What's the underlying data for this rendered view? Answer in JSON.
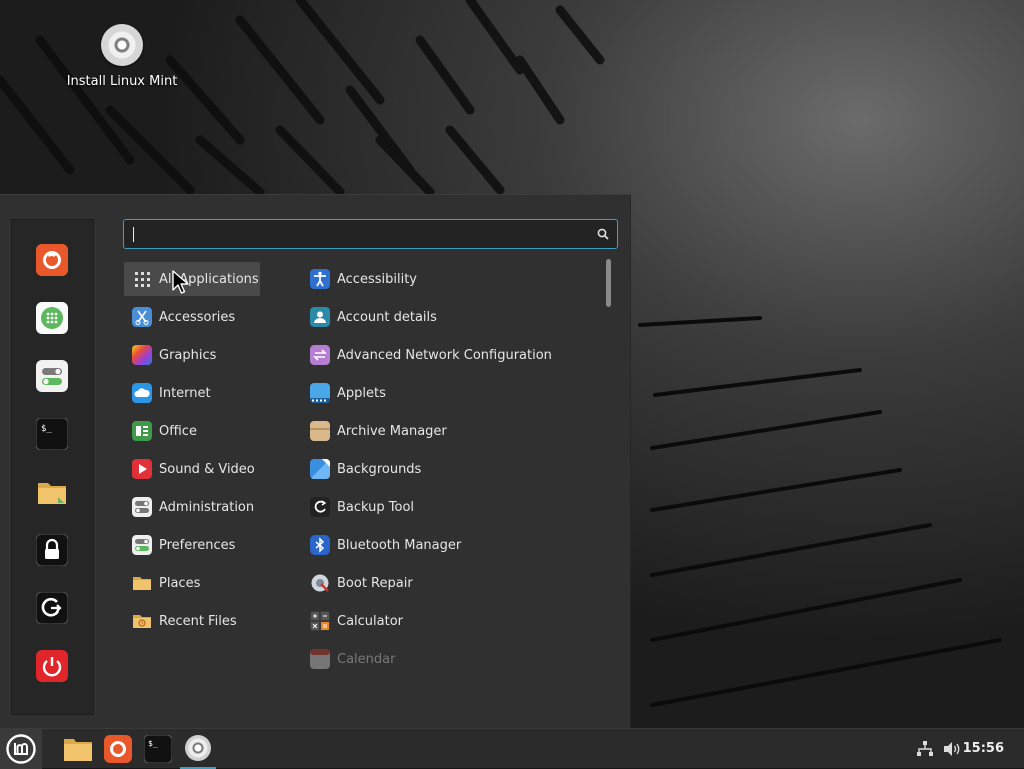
{
  "desktop": {
    "icons": [
      {
        "label": "Install Linux Mint",
        "icon": "disc-icon"
      }
    ]
  },
  "menu": {
    "favorites": [
      {
        "name": "firefox",
        "icon": "firefox-icon"
      },
      {
        "name": "software-manager",
        "icon": "software-manager-icon"
      },
      {
        "name": "system-settings",
        "icon": "settings-toggle-icon"
      },
      {
        "name": "terminal",
        "icon": "terminal-icon"
      },
      {
        "name": "files",
        "icon": "folder-icon"
      },
      {
        "name": "lock-screen",
        "icon": "lock-icon"
      },
      {
        "name": "logout",
        "icon": "logout-icon"
      },
      {
        "name": "shutdown",
        "icon": "power-icon"
      }
    ],
    "search": {
      "value": "",
      "placeholder": ""
    },
    "categories": [
      {
        "label": "All Applications",
        "icon": "grid-icon",
        "active": true
      },
      {
        "label": "Accessories",
        "icon": "scissors-icon"
      },
      {
        "label": "Graphics",
        "icon": "graphics-icon"
      },
      {
        "label": "Internet",
        "icon": "cloud-icon"
      },
      {
        "label": "Office",
        "icon": "office-icon"
      },
      {
        "label": "Sound & Video",
        "icon": "play-icon"
      },
      {
        "label": "Administration",
        "icon": "admin-icon"
      },
      {
        "label": "Preferences",
        "icon": "preferences-icon"
      },
      {
        "label": "Places",
        "icon": "folder-icon"
      },
      {
        "label": "Recent Files",
        "icon": "recent-folder-icon"
      }
    ],
    "applications": [
      {
        "label": "Accessibility",
        "icon": "accessibility-icon"
      },
      {
        "label": "Account details",
        "icon": "account-icon"
      },
      {
        "label": "Advanced Network Configuration",
        "icon": "network-config-icon"
      },
      {
        "label": "Applets",
        "icon": "applets-icon"
      },
      {
        "label": "Archive Manager",
        "icon": "archive-icon"
      },
      {
        "label": "Backgrounds",
        "icon": "backgrounds-icon"
      },
      {
        "label": "Backup Tool",
        "icon": "backup-icon"
      },
      {
        "label": "Bluetooth Manager",
        "icon": "bluetooth-icon"
      },
      {
        "label": "Boot Repair",
        "icon": "boot-repair-icon"
      },
      {
        "label": "Calculator",
        "icon": "calculator-icon"
      },
      {
        "label": "Calendar",
        "icon": "calendar-icon",
        "dimmed": true
      }
    ]
  },
  "panel": {
    "clock": "15:56",
    "launchers": [
      "folder-icon",
      "firefox-icon",
      "terminal-icon",
      "disc-icon"
    ],
    "tray": [
      "network-icon",
      "volume-icon"
    ]
  },
  "colors": {
    "accent": "#3d9fc2",
    "panel": "#2b2b2b",
    "menu": "#303030"
  }
}
